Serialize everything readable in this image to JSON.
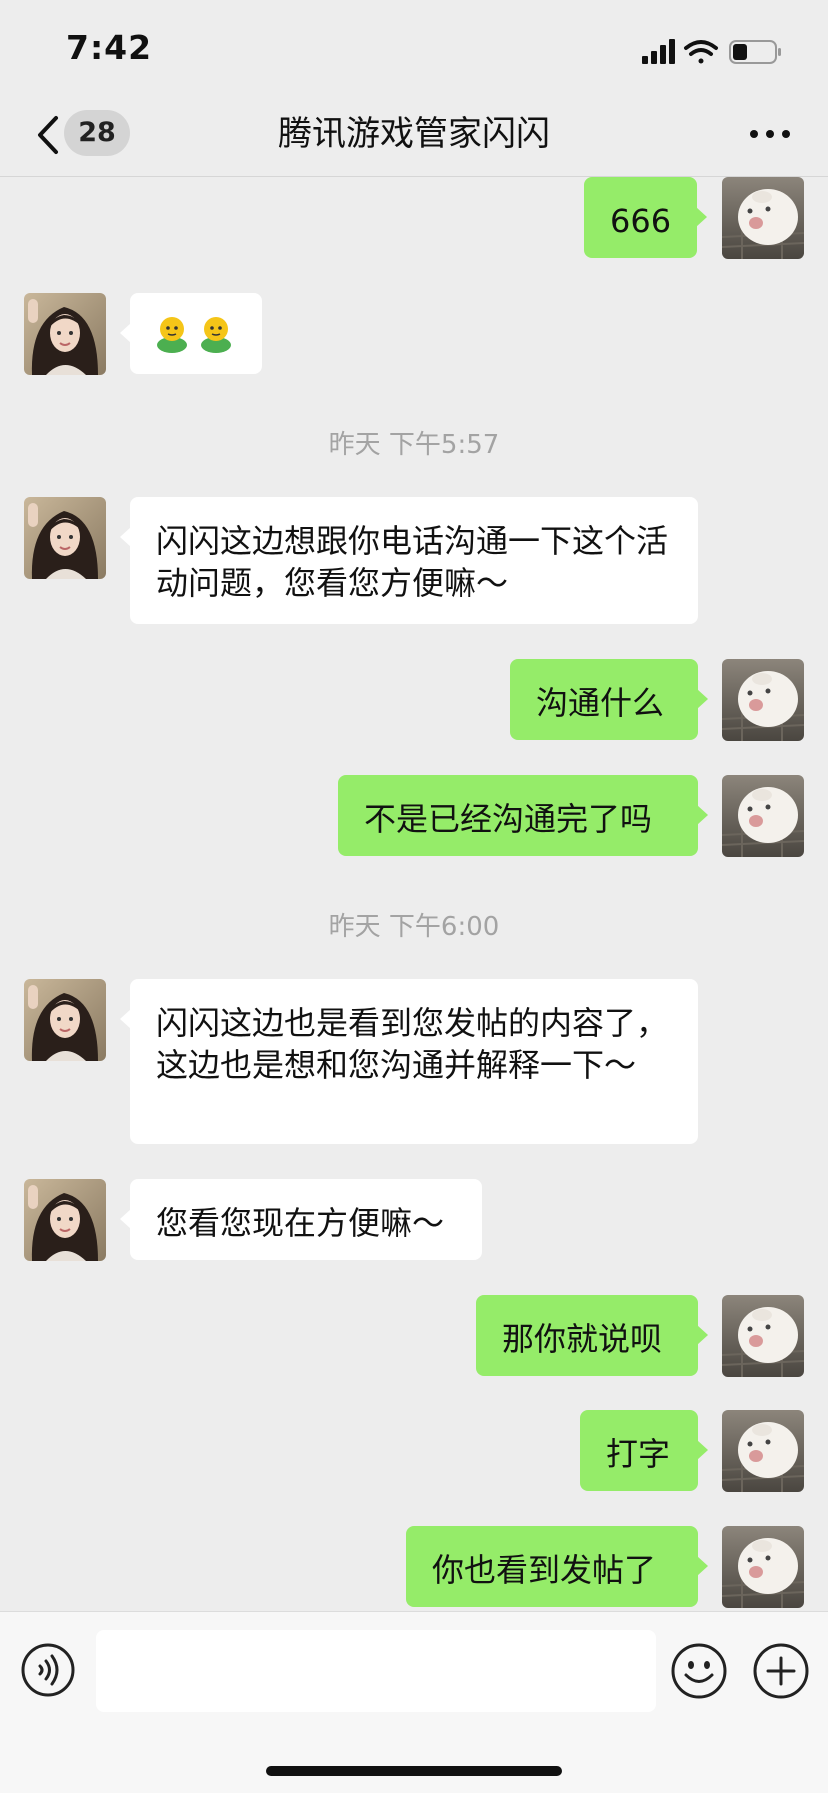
{
  "status_bar": {
    "time": "7:42",
    "battery_level": 0.35
  },
  "nav": {
    "unread_count": "28",
    "title": "腾讯游戏管家闪闪"
  },
  "messages": [
    {
      "side": "out",
      "text": "666"
    },
    {
      "side": "in",
      "text": "",
      "sticker": "two-green-figures"
    },
    {
      "timestamp": "昨天 下午5:57"
    },
    {
      "side": "in",
      "text": "闪闪这边想跟你电话沟通一下这个活动问题，您看您方便嘛～"
    },
    {
      "side": "out",
      "text": "沟通什么"
    },
    {
      "side": "out",
      "text": "不是已经沟通完了吗"
    },
    {
      "timestamp": "昨天 下午6:00"
    },
    {
      "side": "in",
      "text": "闪闪这边也是看到您发帖的内容了，这边也是想和您沟通并解释一下～"
    },
    {
      "side": "in",
      "text": "您看您现在方便嘛～"
    },
    {
      "side": "out",
      "text": "那你就说呗"
    },
    {
      "side": "out",
      "text": "打字"
    },
    {
      "side": "out",
      "text": "你也看到发帖了"
    }
  ],
  "input": {
    "value": "",
    "placeholder": ""
  },
  "colors": {
    "background": "#ededed",
    "outgoing_bubble": "#95ec69",
    "incoming_bubble": "#ffffff"
  },
  "icons": [
    "back-chevron-icon",
    "more-icon",
    "voice-icon",
    "emoji-icon",
    "plus-icon",
    "signal-icon",
    "wifi-icon",
    "battery-icon"
  ]
}
